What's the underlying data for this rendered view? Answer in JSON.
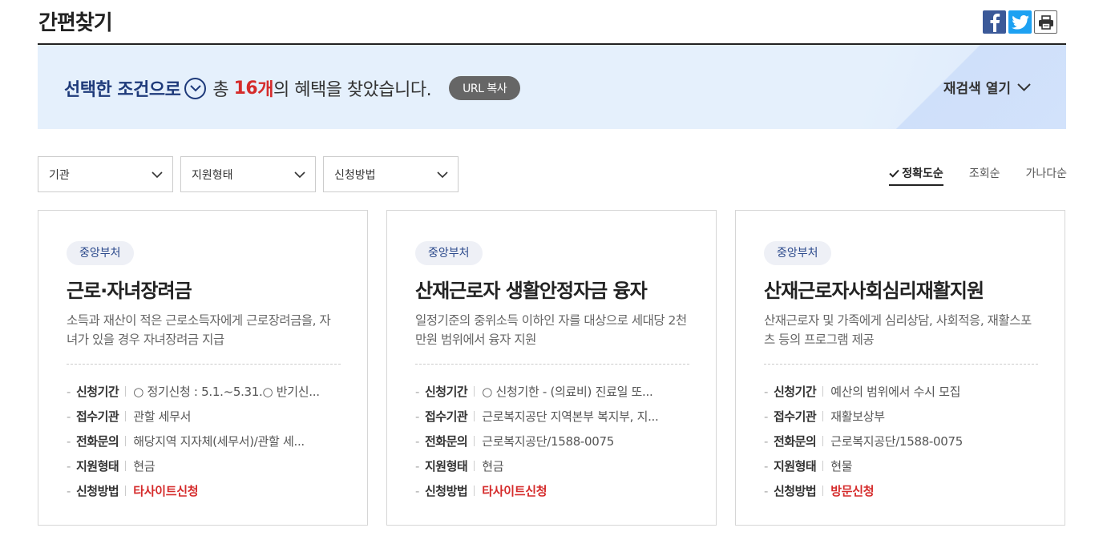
{
  "header": {
    "title": "간편찾기"
  },
  "summary": {
    "condition_label": "선택한 조건으로",
    "total_prefix": "총",
    "count": "16",
    "count_unit": "개",
    "suffix": "의 혜택을 찾았습니다.",
    "url_copy_label": "URL 복사",
    "reopen_label": "재검색 열기"
  },
  "filters": [
    {
      "label": "기관"
    },
    {
      "label": "지원형태"
    },
    {
      "label": "신청방법"
    }
  ],
  "sort": {
    "options": [
      "정확도순",
      "조회순",
      "가나다순"
    ],
    "active": "정확도순"
  },
  "cards": [
    {
      "badge": "중앙부처",
      "title": "근로·자녀장려금",
      "desc": "소득과 재산이 적은 근로소득자에게 근로장려금을, 자녀가 있을 경우 자녀장려금 지급",
      "info": [
        {
          "k": "신청기간",
          "v": "○ 정기신청 : 5.1.~5.31.○ 반기신..."
        },
        {
          "k": "접수기관",
          "v": "관할 세무서"
        },
        {
          "k": "전화문의",
          "v": "해당지역 지자체(세무서)/관할 세..."
        },
        {
          "k": "지원형태",
          "v": "현금"
        },
        {
          "k": "신청방법",
          "v": "타사이트신청"
        }
      ]
    },
    {
      "badge": "중앙부처",
      "title": "산재근로자 생활안정자금 융자",
      "desc": "일정기준의 중위소득 이하인 자를 대상으로 세대당 2천만원 범위에서 융자 지원",
      "info": [
        {
          "k": "신청기간",
          "v": "○ 신청기한 - (의료비) 진료일 또..."
        },
        {
          "k": "접수기관",
          "v": "근로복지공단 지역본부 복지부, 지..."
        },
        {
          "k": "전화문의",
          "v": "근로복지공단/1588-0075"
        },
        {
          "k": "지원형태",
          "v": "현금"
        },
        {
          "k": "신청방법",
          "v": "타사이트신청"
        }
      ]
    },
    {
      "badge": "중앙부처",
      "title": "산재근로자사회심리재활지원",
      "desc": "산재근로자 및 가족에게 심리상담, 사회적응, 재활스포츠 등의 프로그램 제공",
      "info": [
        {
          "k": "신청기간",
          "v": "예산의 범위에서 수시 모집"
        },
        {
          "k": "접수기관",
          "v": "재활보상부"
        },
        {
          "k": "전화문의",
          "v": "근로복지공단/1588-0075"
        },
        {
          "k": "지원형태",
          "v": "현물"
        },
        {
          "k": "신청방법",
          "v": "방문신청"
        }
      ]
    }
  ],
  "colors": {
    "accent_red": "#d52b2b",
    "navy": "#1e3a7a",
    "summary_bg": "#e5f0fc",
    "facebook": "#3b5998",
    "twitter": "#1da1f2"
  }
}
